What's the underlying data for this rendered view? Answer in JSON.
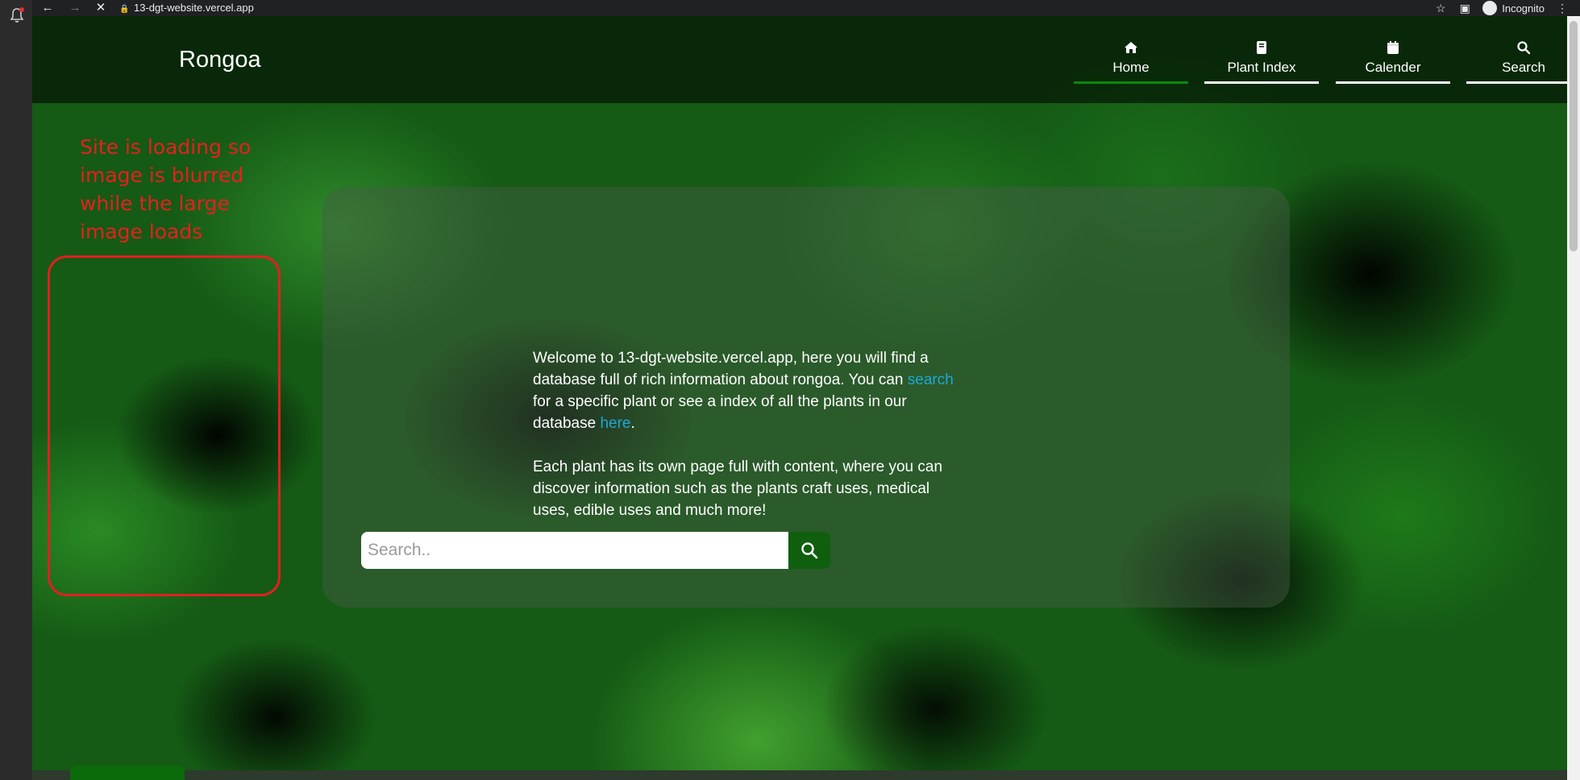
{
  "browser": {
    "url": "13-dgt-website.vercel.app",
    "profile_label": "Incognito"
  },
  "header": {
    "brand": "Rongoa",
    "nav": [
      {
        "label": "Home",
        "icon": "home-icon",
        "active": true
      },
      {
        "label": "Plant Index",
        "icon": "book-icon",
        "active": false
      },
      {
        "label": "Calender",
        "icon": "calendar-icon",
        "active": false
      },
      {
        "label": "Search",
        "icon": "search-icon",
        "active": false
      }
    ]
  },
  "annotation": {
    "text": "Site is loading so image is blurred while the large image loads",
    "color": "#e81f1f"
  },
  "welcome": {
    "p1_before": "Welcome to 13-dgt-website.vercel.app, here you will find a database full of rich information about rongoa. You can ",
    "p1_link1": "search",
    "p1_middle": " for a specific plant or see a index of all the plants in our database ",
    "p1_link2": "here",
    "p1_after": ".",
    "p2": "Each plant has its own page full with content, where you can discover information such as the plants craft uses, medical uses, edible uses and much more!"
  },
  "search": {
    "placeholder": "Search.."
  },
  "colors": {
    "accent_green": "#0a8a0a",
    "link": "#1ea8d6",
    "search_button": "#0f5f0f"
  }
}
